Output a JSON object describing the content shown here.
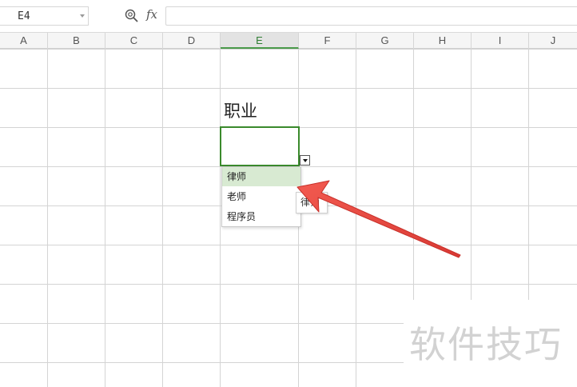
{
  "formula_bar": {
    "cell_reference": "E4",
    "function_label": "fx",
    "formula_value": ""
  },
  "columns": [
    "A",
    "B",
    "C",
    "D",
    "E",
    "F",
    "G",
    "H",
    "I",
    "J"
  ],
  "active_column": "E",
  "cells": {
    "E3": "职业",
    "E4": ""
  },
  "dropdown": {
    "options": [
      "律师",
      "老师",
      "程序员"
    ],
    "highlighted_option": "律师"
  },
  "tooltip": {
    "text": "律师"
  },
  "annotation_arrow_color": "#e8423c",
  "selection_color": "#3a8a2c",
  "watermark": "软件技巧"
}
